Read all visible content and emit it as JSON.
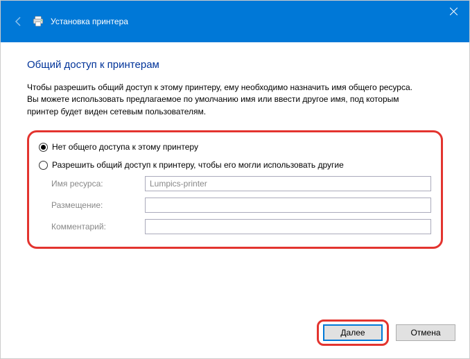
{
  "window": {
    "title": "Установка принтера"
  },
  "page": {
    "heading": "Общий доступ к принтерам",
    "description": "Чтобы разрешить общий доступ к этому принтеру, ему необходимо назначить имя общего ресурса. Вы можете использовать предлагаемое по умолчанию имя или ввести другое имя, под которым принтер будет виден сетевым пользователям."
  },
  "options": {
    "no_share_label": "Нет общего доступа к этому принтеру",
    "share_label": "Разрешить общий доступ к принтеру, чтобы его могли использовать другие"
  },
  "fields": {
    "resource_name_label": "Имя ресурса:",
    "resource_name_value": "Lumpics-printer",
    "location_label": "Размещение:",
    "location_value": "",
    "comment_label": "Комментарий:",
    "comment_value": ""
  },
  "buttons": {
    "next": "Далее",
    "cancel": "Отмена"
  }
}
